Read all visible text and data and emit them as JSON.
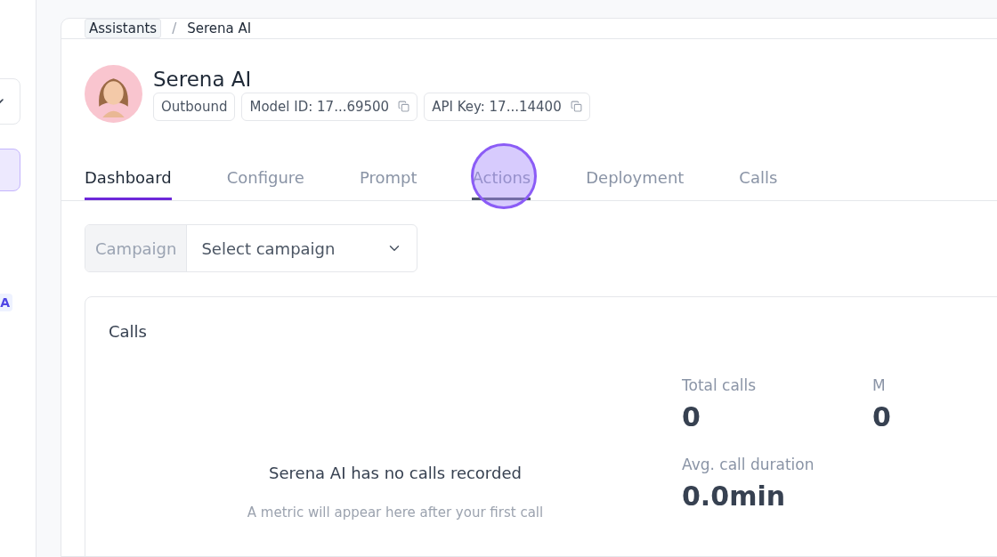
{
  "sidebar": {
    "items": [
      {
        "selected": true
      }
    ],
    "badge": {
      "label": "A"
    }
  },
  "breadcrumb": {
    "separator": "/",
    "items": [
      {
        "label": "Assistants",
        "kind": "link"
      },
      {
        "label": "Serena AI",
        "kind": "current"
      }
    ]
  },
  "assistant": {
    "name": "Serena AI",
    "tags": [
      {
        "label": "Outbound",
        "copyable": false
      },
      {
        "label": "Model ID: 17...69500",
        "copyable": true
      },
      {
        "label": "API Key: 17...14400",
        "copyable": true
      }
    ]
  },
  "tabs": [
    {
      "label": "Dashboard",
      "selected": true,
      "hovered": false
    },
    {
      "label": "Configure",
      "selected": false,
      "hovered": false
    },
    {
      "label": "Prompt",
      "selected": false,
      "hovered": false
    },
    {
      "label": "Actions",
      "selected": false,
      "hovered": true
    },
    {
      "label": "Deployment",
      "selected": false,
      "hovered": false
    },
    {
      "label": "Calls",
      "selected": false,
      "hovered": false
    }
  ],
  "campaign": {
    "label": "Campaign",
    "placeholder": "Select campaign"
  },
  "calls_card": {
    "title": "Calls",
    "empty_title": "Serena AI has no calls recorded",
    "empty_text": "A metric will appear here after your first call",
    "stats": [
      {
        "label": "Total calls",
        "value": "0"
      },
      {
        "label": "M",
        "value": "0"
      },
      {
        "label": "Avg. call duration",
        "value": "0.0min"
      }
    ]
  }
}
